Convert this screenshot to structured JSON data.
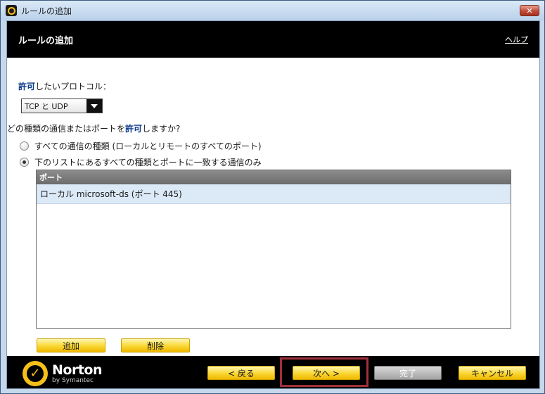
{
  "window": {
    "title": "ルールの追加"
  },
  "header": {
    "title": "ルールの追加",
    "help": "ヘルプ"
  },
  "protocol": {
    "label_emphasis": "許可",
    "label_rest": "したいプロトコル：",
    "selected": "TCP と UDP"
  },
  "question": {
    "before": "どの種類の通信またはポートを",
    "emphasis": "許可",
    "after": "しますか?"
  },
  "radios": [
    {
      "label": "すべての通信の種類 (ローカルとリモートのすべてのポート)",
      "checked": false
    },
    {
      "label": "下のリストにあるすべての種類とポートに一致する通信のみ",
      "checked": true
    }
  ],
  "ports": {
    "header": "ポート",
    "rows": [
      "ローカル microsoft-ds (ポート 445)"
    ]
  },
  "list_buttons": {
    "add": "追加",
    "delete": "削除"
  },
  "footer": {
    "brand": "Norton",
    "brand_sub": "by Symantec",
    "back": "< 戻る",
    "next": "次へ >",
    "finish": "完了",
    "cancel": "キャンセル"
  }
}
